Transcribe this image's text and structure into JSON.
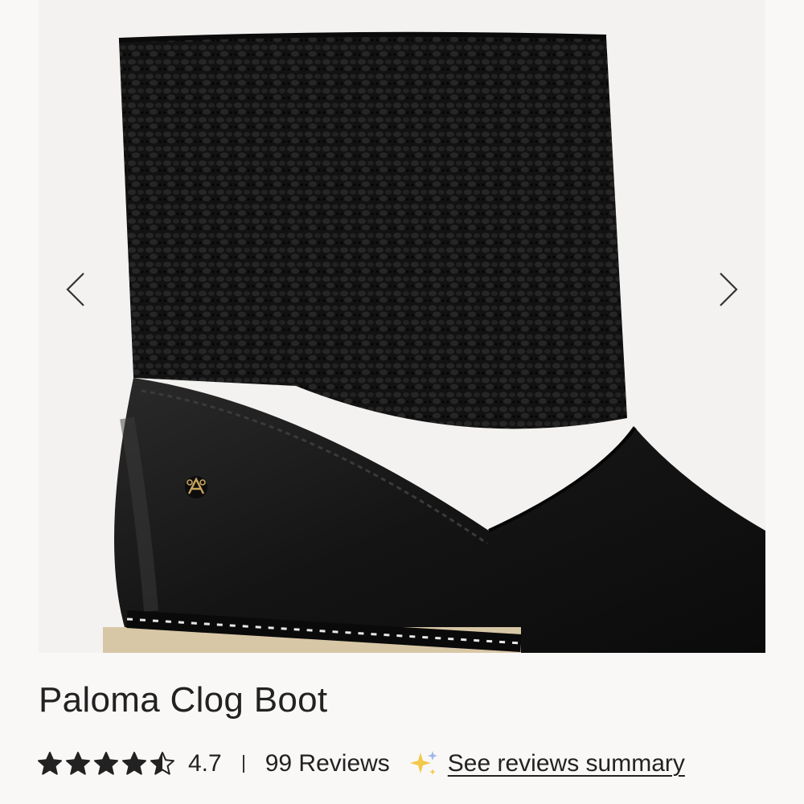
{
  "product": {
    "title": "Paloma Clog Boot",
    "rating": {
      "value_label": "4.7",
      "value": 4.7,
      "max": 5
    },
    "reviews": {
      "count_label": "99 Reviews",
      "summary_link": "See reviews summary"
    }
  },
  "gallery": {
    "image_alt": "Paloma Clog Boot - black crochet shaft with black leather lower",
    "prev_icon": "chevron-left-icon",
    "next_icon": "chevron-right-icon"
  },
  "colors": {
    "background": "#faf8f7",
    "text": "#222222",
    "star": "#222222",
    "sparkle": "#f2c94c"
  }
}
